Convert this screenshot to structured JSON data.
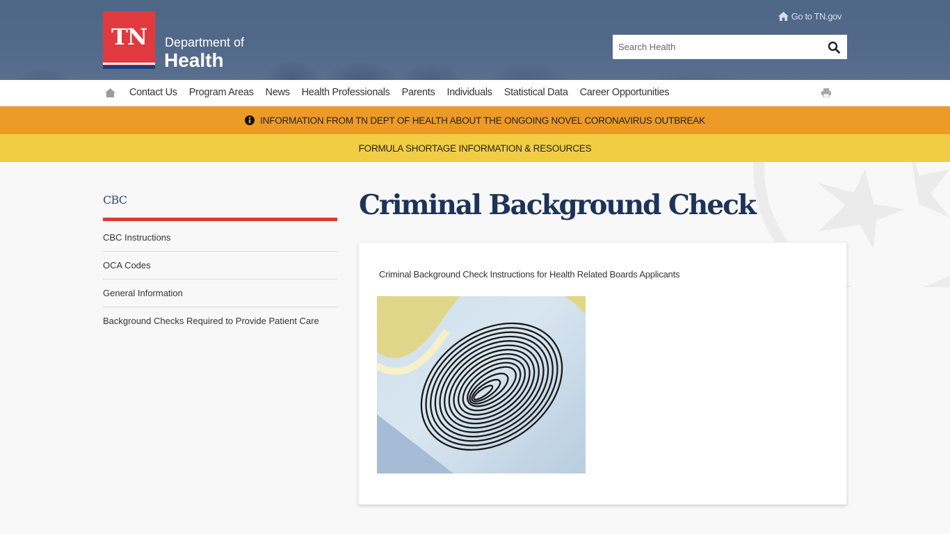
{
  "header": {
    "logo_text": "TN",
    "dept_line1": "Department of",
    "dept_line2": "Health",
    "go_tn_label": "Go to TN.gov",
    "search": {
      "placeholder": "Search Health",
      "value": ""
    }
  },
  "nav": {
    "items": [
      {
        "label": "Contact Us"
      },
      {
        "label": "Program Areas"
      },
      {
        "label": "News"
      },
      {
        "label": "Health Professionals"
      },
      {
        "label": "Parents"
      },
      {
        "label": "Individuals"
      },
      {
        "label": "Statistical Data"
      },
      {
        "label": "Career Opportunities"
      }
    ]
  },
  "banners": {
    "coronavirus": "INFORMATION FROM TN DEPT OF HEALTH ABOUT THE ONGOING NOVEL CORONAVIRUS OUTBREAK",
    "formula": "FORMULA SHORTAGE INFORMATION & RESOURCES"
  },
  "sidebar": {
    "title": "CBC",
    "items": [
      {
        "label": "CBC Instructions"
      },
      {
        "label": "OCA Codes"
      },
      {
        "label": "General Information"
      },
      {
        "label": "Background Checks Required to Provide Patient Care"
      }
    ]
  },
  "main": {
    "title": "Criminal Background Check",
    "card": {
      "description": "Criminal Background Check Instructions for Health Related Boards Applicants",
      "image_alt": "fingerprint"
    }
  },
  "colors": {
    "header_bg": "#53698a",
    "logo_red": "#e03a3e",
    "banner_orange": "#ee9a27",
    "banner_yellow": "#f2cd44",
    "title_navy": "#1e3358",
    "sidebar_rule": "#e03a30"
  }
}
